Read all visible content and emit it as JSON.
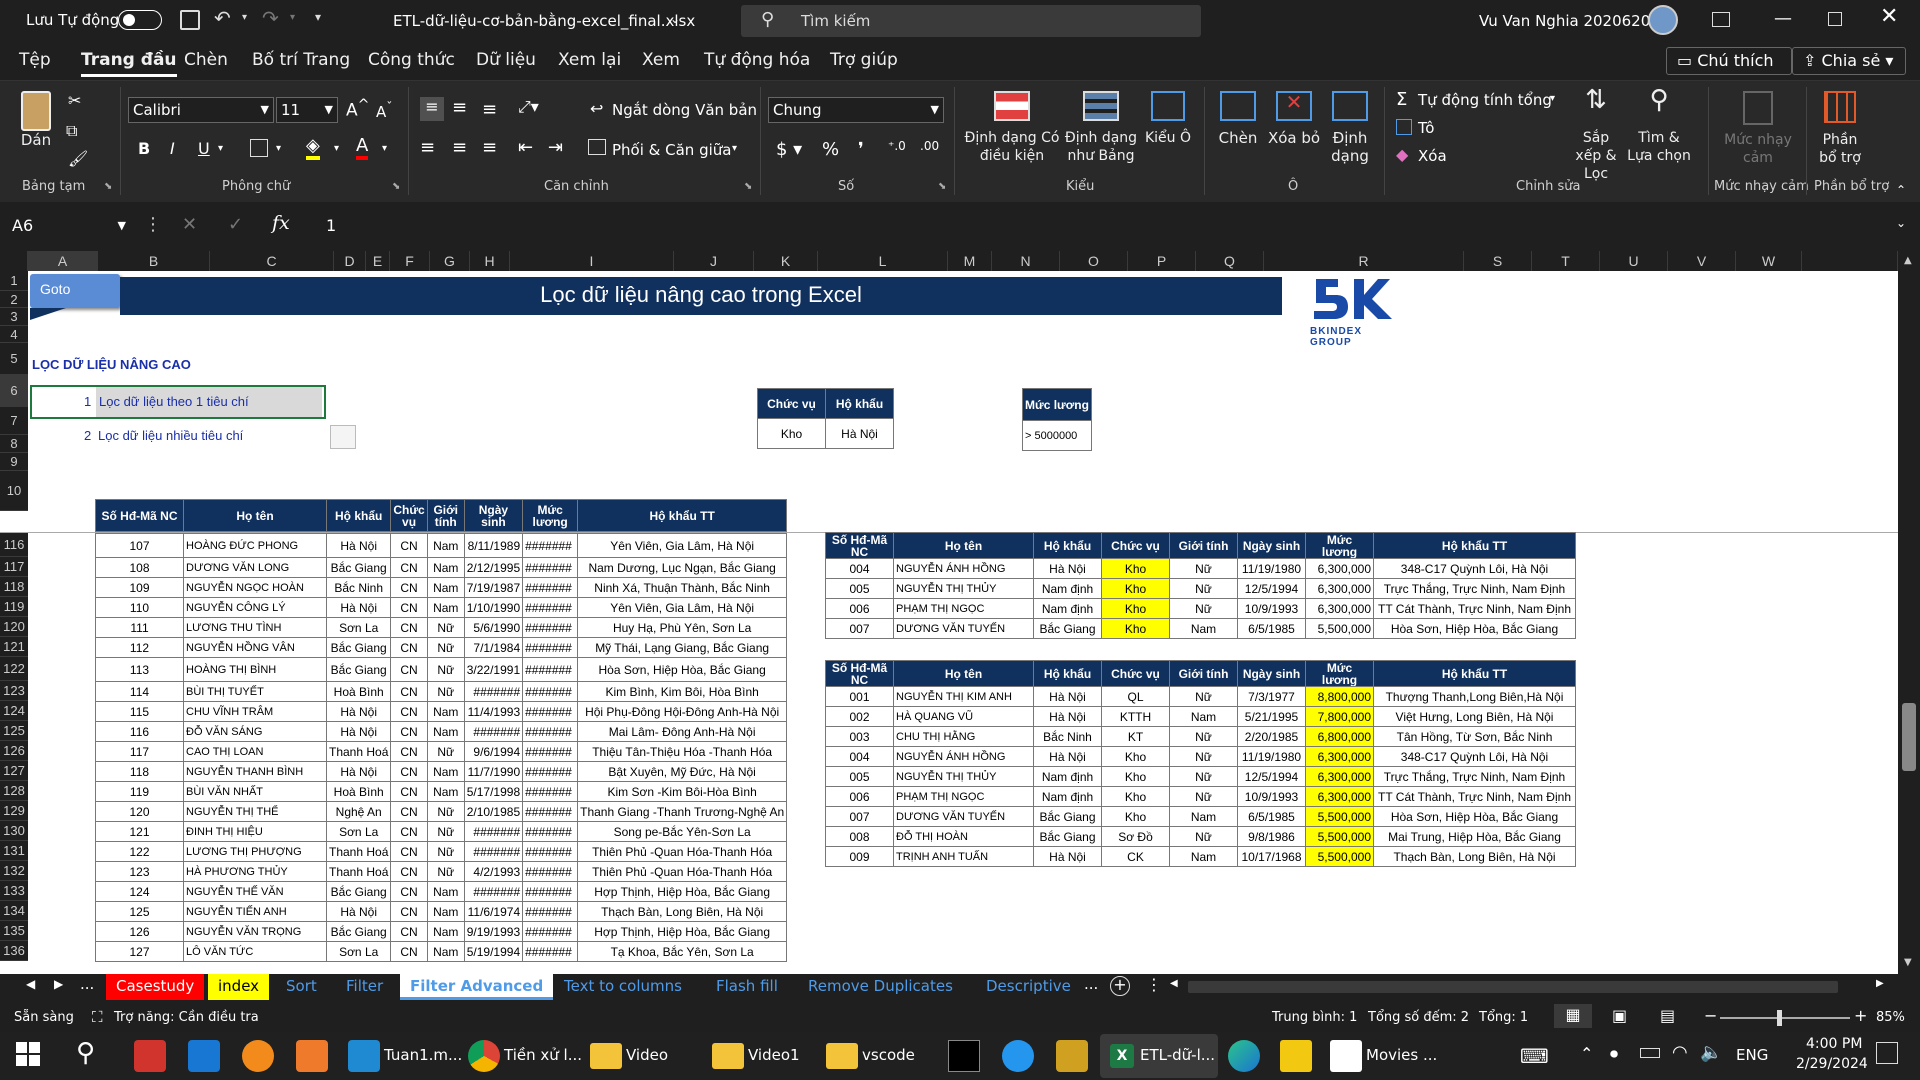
{
  "titlebar": {
    "autosave": "Lưu Tự động",
    "filename": "ETL-dữ-liệu-cơ-bản-bằng-excel_final.xlsx",
    "search": "Tìm kiếm",
    "user": "Vu Van Nghia 20206205"
  },
  "menu": [
    "Tệp",
    "Trang đầu",
    "Chèn",
    "Bố trí Trang",
    "Công thức",
    "Dữ liệu",
    "Xem lại",
    "Xem",
    "Tự động hóa",
    "Trợ giúp"
  ],
  "menu_right": {
    "comment": "Chú thích",
    "share": "Chia sẻ"
  },
  "ribbon": {
    "clipboard": {
      "paste": "Dán",
      "label": "Bảng tạm"
    },
    "font": {
      "name": "Calibri",
      "size": "11",
      "label": "Phông chữ"
    },
    "align": {
      "wrap": "Ngắt dòng Văn bản",
      "merge": "Phối & Căn giữa",
      "label": "Căn chỉnh"
    },
    "number": {
      "format": "Chung",
      "label": "Số"
    },
    "styles": {
      "cond": "Định dạng Có điều kiện",
      "table": "Định dạng như Bảng",
      "cell": "Kiểu Ô",
      "label": "Kiểu"
    },
    "cells": {
      "insert": "Chèn",
      "delete": "Xóa bỏ",
      "format": "Định dạng",
      "label": "Ô"
    },
    "editing": {
      "autosum": "Tự động tính tổng",
      "fill": "Tô",
      "clear": "Xóa",
      "sort": "Sắp xếp & Lọc",
      "find": "Tìm & Lựa chọn",
      "label": "Chỉnh sửa"
    },
    "sens": {
      "btn": "Mức nhạy cảm",
      "label": "Mức nhạy cảm"
    },
    "addin": {
      "btn": "Phần bổ trợ",
      "label": "Phần bổ trợ"
    }
  },
  "formula": {
    "cell": "A6",
    "value": "1"
  },
  "columns": [
    "A",
    "B",
    "C",
    "D",
    "E",
    "F",
    "G",
    "H",
    "I",
    "J",
    "K",
    "L",
    "M",
    "N",
    "O",
    "P",
    "Q",
    "R",
    "S",
    "T",
    "U",
    "V",
    "W"
  ],
  "sheet": {
    "goto": "Goto",
    "banner": "Lọc dữ liệu nâng cao trong Excel",
    "section": "LỌC DỮ LIỆU NÂNG CAO",
    "opt1_n": "1",
    "opt1": "Lọc dữ liệu theo 1 tiêu chí",
    "opt2_n": "2",
    "opt2": "Lọc dữ liệu nhiều tiêu chí",
    "logo_sub": "BKINDEX GROUP",
    "crit1": {
      "h1": "Chức vụ",
      "h2": "Hộ khẩu",
      "v1": "Kho",
      "v2": "Hà Nội"
    },
    "crit2": {
      "h": "Mức lương",
      "v": "> 5000000"
    }
  },
  "rows_top": [
    "1",
    "2",
    "3",
    "4",
    "5",
    "6",
    "7",
    "8",
    "9",
    "10"
  ],
  "main_headers": [
    "Số Hđ-Mã NC",
    "Họ tên",
    "Hộ khẩu",
    "Chức vụ",
    "Giới tính",
    "Ngày sinh",
    "Mức lương",
    "Hộ khẩu TT"
  ],
  "main_rows": [
    [
      "116",
      "107",
      "HOÀNG ĐỨC PHONG",
      "Hà Nội",
      "CN",
      "Nam",
      "8/11/1989",
      "#######",
      "Yên Viên, Gia Lâm, Hà Nội"
    ],
    [
      "117",
      "108",
      "DƯƠNG VĂN LONG",
      "Bắc Giang",
      "CN",
      "Nam",
      "2/12/1995",
      "#######",
      "Nam Dương, Lục Ngạn, Bắc Giang"
    ],
    [
      "118",
      "109",
      "NGUYỄN NGỌC HOÀN",
      "Bắc Ninh",
      "CN",
      "Nam",
      "7/19/1987",
      "#######",
      "Ninh Xá, Thuận Thành, Bắc Ninh"
    ],
    [
      "119",
      "110",
      "NGUYỄN CÔNG LÝ",
      "Hà Nội",
      "CN",
      "Nam",
      "1/10/1990",
      "#######",
      "Yên Viên, Gia Lâm, Hà Nội"
    ],
    [
      "120",
      "111",
      "LƯƠNG THU TÌNH",
      "Sơn La",
      "CN",
      "Nữ",
      "5/6/1990",
      "#######",
      "Huy Hạ, Phù Yên, Sơn La"
    ],
    [
      "121",
      "112",
      "NGUYỄN HỒNG VÂN",
      "Bắc Giang",
      "CN",
      "Nữ",
      "7/1/1984",
      "#######",
      "Mỹ Thái, Lạng Giang, Bắc Giang"
    ],
    [
      "122",
      "113",
      "HOÀNG THỊ BÌNH",
      "Bắc Giang",
      "CN",
      "Nữ",
      "3/22/1991",
      "#######",
      "Hòa Sơn, Hiệp Hòa, Bắc Giang"
    ],
    [
      "123",
      "114",
      "BÙI THỊ TUYẾT",
      "Hoà Bình",
      "CN",
      "Nữ",
      "#######",
      "#######",
      "Kim Bình, Kim Bôi, Hòa Bình"
    ],
    [
      "124",
      "115",
      "CHU VĨNH TRÂM",
      "Hà Nội",
      "CN",
      "Nam",
      "11/4/1993",
      "#######",
      "Hội Phụ-Đông Hội-Đông Anh-Hà Nội"
    ],
    [
      "125",
      "116",
      "ĐỖ VĂN SÁNG",
      "Hà Nội",
      "CN",
      "Nam",
      "#######",
      "#######",
      "Mai Lâm- Đông Anh-Hà Nội"
    ],
    [
      "126",
      "117",
      "CAO THỊ LOAN",
      "Thanh Hoá",
      "CN",
      "Nữ",
      "9/6/1994",
      "#######",
      "Thiệu Tân-Thiệu Hóa -Thanh Hóa"
    ],
    [
      "127",
      "118",
      "NGUYỄN THANH BÌNH",
      "Hà Nội",
      "CN",
      "Nam",
      "11/7/1990",
      "#######",
      "Bật Xuyên, Mỹ Đức, Hà Nội"
    ],
    [
      "128",
      "119",
      "BÙI VĂN NHẤT",
      "Hoà Bình",
      "CN",
      "Nam",
      "5/17/1998",
      "#######",
      "Kim Sơn -Kim Bôi-Hòa Bình"
    ],
    [
      "129",
      "120",
      "NGUYỄN THỊ THỂ",
      "Nghệ An",
      "CN",
      "Nữ",
      "2/10/1985",
      "#######",
      "Thanh Giang -Thanh Trương-Nghệ An"
    ],
    [
      "130",
      "121",
      "ĐINH THỊ HIỆU",
      "Sơn La",
      "CN",
      "Nữ",
      "#######",
      "#######",
      "Song pe-Bắc Yên-Sơn La"
    ],
    [
      "131",
      "122",
      "LƯƠNG THỊ PHƯỢNG",
      "Thanh Hoá",
      "CN",
      "Nữ",
      "#######",
      "#######",
      "Thiên Phủ -Quan Hóa-Thanh Hóa"
    ],
    [
      "132",
      "123",
      "HÀ PHƯƠNG THỦY",
      "Thanh Hoá",
      "CN",
      "Nữ",
      "4/2/1993",
      "#######",
      "Thiên Phủ -Quan Hóa-Thanh Hóa"
    ],
    [
      "133",
      "124",
      "NGUYỄN THẾ VĂN",
      "Bắc Giang",
      "CN",
      "Nam",
      "#######",
      "#######",
      "Hợp Thịnh, Hiệp Hòa, Bắc Giang"
    ],
    [
      "134",
      "125",
      "NGUYỄN TIẾN ANH",
      "Hà Nội",
      "CN",
      "Nam",
      "11/6/1974",
      "#######",
      "Thạch Bàn, Long Biên, Hà Nội"
    ],
    [
      "135",
      "126",
      "NGUYỄN VĂN TRỌNG",
      "Bắc Giang",
      "CN",
      "Nam",
      "9/19/1993",
      "#######",
      "Hợp Thịnh, Hiệp Hòa, Bắc Giang"
    ],
    [
      "136",
      "127",
      "LÔ VĂN TỨC",
      "Sơn La",
      "CN",
      "Nam",
      "5/19/1994",
      "#######",
      "Tạ Khoa, Bắc Yên, Sơn La"
    ]
  ],
  "result1": [
    [
      "004",
      "NGUYỄN ÁNH HỒNG",
      "Hà Nội",
      "Kho",
      "Nữ",
      "11/19/1980",
      "6,300,000",
      "348-C17 Quỳnh Lôi, Hà Nội"
    ],
    [
      "005",
      "NGUYỄN THỊ THỦY",
      "Nam định",
      "Kho",
      "Nữ",
      "12/5/1994",
      "6,300,000",
      "Trực Thắng, Trực Ninh, Nam Định"
    ],
    [
      "006",
      "PHẠM THỊ NGỌC",
      "Nam định",
      "Kho",
      "Nữ",
      "10/9/1993",
      "6,300,000",
      "TT Cát Thành, Trực Ninh, Nam Định"
    ],
    [
      "007",
      "DƯƠNG VĂN TUYẾN",
      "Bắc Giang",
      "Kho",
      "Nam",
      "6/5/1985",
      "5,500,000",
      "Hòa Sơn, Hiệp Hòa, Bắc Giang"
    ]
  ],
  "result2": [
    [
      "001",
      "NGUYỄN THỊ KIM ANH",
      "Hà Nội",
      "QL",
      "Nữ",
      "7/3/1977",
      "8,800,000",
      "Thượng Thanh,Long Biên,Hà Nội"
    ],
    [
      "002",
      "HÀ QUANG VŨ",
      "Hà Nội",
      "KTTH",
      "Nam",
      "5/21/1995",
      "7,800,000",
      "Việt Hưng, Long Biên, Hà Nội"
    ],
    [
      "003",
      "CHU THỊ HẰNG",
      "Bắc Ninh",
      "KT",
      "Nữ",
      "2/20/1985",
      "6,800,000",
      "Tân Hồng, Từ Sơn, Bắc Ninh"
    ],
    [
      "004",
      "NGUYỄN ÁNH HỒNG",
      "Hà Nội",
      "Kho",
      "Nữ",
      "11/19/1980",
      "6,300,000",
      "348-C17 Quỳnh Lôi, Hà Nội"
    ],
    [
      "005",
      "NGUYỄN THỊ THỦY",
      "Nam định",
      "Kho",
      "Nữ",
      "12/5/1994",
      "6,300,000",
      "Trực Thắng, Trực Ninh, Nam Định"
    ],
    [
      "006",
      "PHẠM THỊ NGỌC",
      "Nam định",
      "Kho",
      "Nữ",
      "10/9/1993",
      "6,300,000",
      "TT Cát Thành, Trực Ninh, Nam Định"
    ],
    [
      "007",
      "DƯƠNG VĂN TUYẾN",
      "Bắc Giang",
      "Kho",
      "Nam",
      "6/5/1985",
      "5,500,000",
      "Hòa Sơn, Hiệp Hòa, Bắc Giang"
    ],
    [
      "008",
      "ĐỖ THỊ HOÀN",
      "Bắc Giang",
      "Sơ Đồ",
      "Nữ",
      "9/8/1986",
      "5,500,000",
      "Mai Trung, Hiệp Hòa, Bắc Giang"
    ],
    [
      "009",
      "TRỊNH ANH TUẤN",
      "Hà Nội",
      "CK",
      "Nam",
      "10/17/1968",
      "5,500,000",
      "Thạch Bàn, Long Biên, Hà Nội"
    ]
  ],
  "tabs": [
    "Casestudy",
    "index",
    "Sort",
    "Filter",
    "Filter Advanced",
    "Text to columns",
    "Flash fill",
    "Remove Duplicates",
    "Descriptive s"
  ],
  "tab_ellipsis": "...",
  "status": {
    "ready": "Sẵn sàng",
    "access": "Trợ năng: Cần điều tra",
    "avg": "Trung bình: 1",
    "count": "Tổng số đếm: 2",
    "sum": "Tổng: 1",
    "zoom": "85%"
  },
  "taskbar": {
    "apps": [
      "Tuan1.m...",
      "Tiền xử l...",
      "Video",
      "Video1",
      "vscode",
      "ETL-dữ-l...",
      "Movies ..."
    ],
    "lang": "ENG",
    "time": "4:00 PM",
    "date": "2/29/2024"
  }
}
